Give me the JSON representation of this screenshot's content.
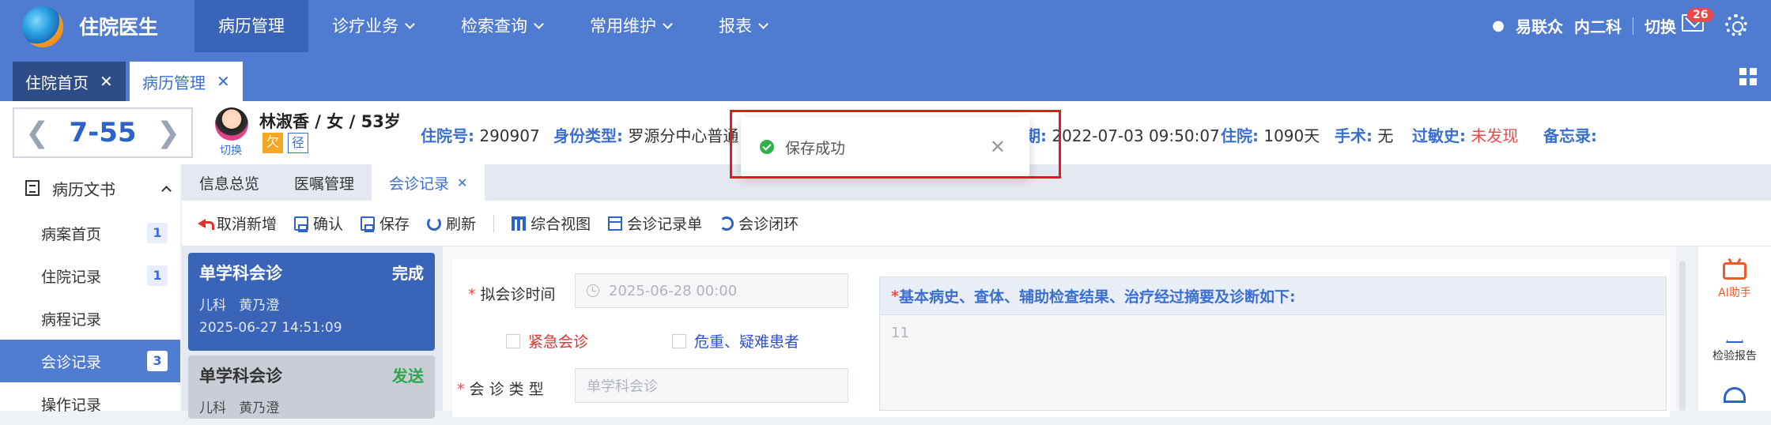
{
  "header": {
    "app_name": "住院医生",
    "nav": [
      {
        "label": "病历管理",
        "active": true
      },
      {
        "label": "诊疗业务",
        "dropdown": true
      },
      {
        "label": "检索查询",
        "dropdown": true
      },
      {
        "label": "常用维护",
        "dropdown": true
      },
      {
        "label": "报表",
        "dropdown": true
      }
    ],
    "user": "易联众",
    "dept": "内二科",
    "switch": "切换",
    "mail_count": "26"
  },
  "page_tabs": [
    {
      "label": "住院首页"
    },
    {
      "label": "病历管理"
    }
  ],
  "patient": {
    "bed": "7-55",
    "switch": "切换",
    "name_line": "林淑香 / 女 / 53岁",
    "tag_owe": "欠",
    "tag_path": "径",
    "admission_no_label": "住院号:",
    "admission_no": "290907",
    "identity_label": "身份类型:",
    "identity": "罗源分中心普通",
    "date_label_tail": "期:",
    "date": "2022-07-03 09:50:07",
    "stay_label": "住院:",
    "stay": "1090天",
    "surgery_label": "手术:",
    "surgery": "无",
    "allergy_label": "过敏史:",
    "allergy": "未发现",
    "memo_label": "备忘录:"
  },
  "sidebar": {
    "title": "病历文书",
    "items": [
      {
        "label": "病案首页",
        "count": "1"
      },
      {
        "label": "住院记录",
        "count": "1"
      },
      {
        "label": "病程记录",
        "count": ""
      },
      {
        "label": "会诊记录",
        "count": "3",
        "active": true
      },
      {
        "label": "操作记录",
        "count": ""
      }
    ]
  },
  "subtabs": [
    {
      "label": "信息总览"
    },
    {
      "label": "医嘱管理"
    },
    {
      "label": "会诊记录",
      "active": true
    }
  ],
  "toolbar": {
    "cancel_new": "取消新增",
    "confirm": "确认",
    "save": "保存",
    "refresh": "刷新",
    "overview": "综合视图",
    "record_form": "会诊记录单",
    "closed_loop": "会诊闭环"
  },
  "records": [
    {
      "title": "单学科会诊",
      "status": "完成",
      "dept": "儿科",
      "doctor": "黄乃澄",
      "time": "2025-06-27 14:51:09"
    },
    {
      "title": "单学科会诊",
      "status": "发送",
      "dept": "儿科",
      "doctor": "黄乃澄"
    }
  ],
  "form": {
    "time_label": "拟会诊时间",
    "time_placeholder": "2025-06-28 00:00",
    "urgent": "紧急会诊",
    "critical": "危重、疑难患者",
    "type_label": "会 诊 类 型",
    "type_placeholder": "单学科会诊",
    "history_label": "基本病史、查体、辅助检查结果、治疗经过摘要及诊断如下:",
    "history_value": "11"
  },
  "right_rail": {
    "ai": "AI助手",
    "lab": "检验报告"
  },
  "toast": {
    "message": "保存成功"
  },
  "colors": {
    "primary": "#4f7bd0",
    "dark_primary": "#3a64b7",
    "danger": "#f04848",
    "success": "#2fb24a",
    "highlight_box": "#e8191c"
  }
}
